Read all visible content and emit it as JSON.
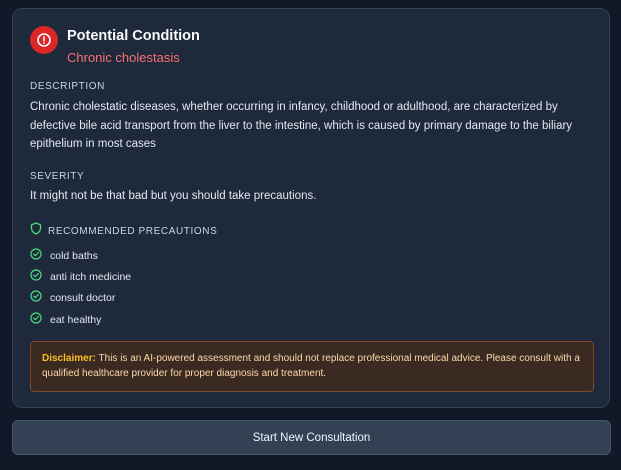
{
  "header": {
    "title": "Potential Condition",
    "condition": "Chronic cholestasis",
    "icon": "alert-circle-icon",
    "accent_color": "#dc2626",
    "condition_color": "#f87171"
  },
  "description": {
    "label": "DESCRIPTION",
    "text": "Chronic cholestatic diseases, whether occurring in infancy, childhood or adulthood, are characterized by defective bile acid transport from the liver to the intestine, which is caused by primary damage to the biliary epithelium in most cases"
  },
  "severity": {
    "label": "SEVERITY",
    "text": "It might not be that bad but you should take precautions."
  },
  "precautions": {
    "label": "RECOMMENDED PRECAUTIONS",
    "icon": "shield-icon",
    "item_icon": "check-circle-icon",
    "check_color": "#4ade80",
    "items": [
      "cold baths",
      "anti itch medicine",
      "consult doctor",
      "eat healthy"
    ]
  },
  "disclaimer": {
    "label": "Disclaimer:",
    "text": " This is an AI-powered assessment and should not replace professional medical advice. Please consult with a qualified healthcare provider for proper diagnosis and treatment."
  },
  "actions": {
    "start_new_label": "Start New Consultation"
  }
}
